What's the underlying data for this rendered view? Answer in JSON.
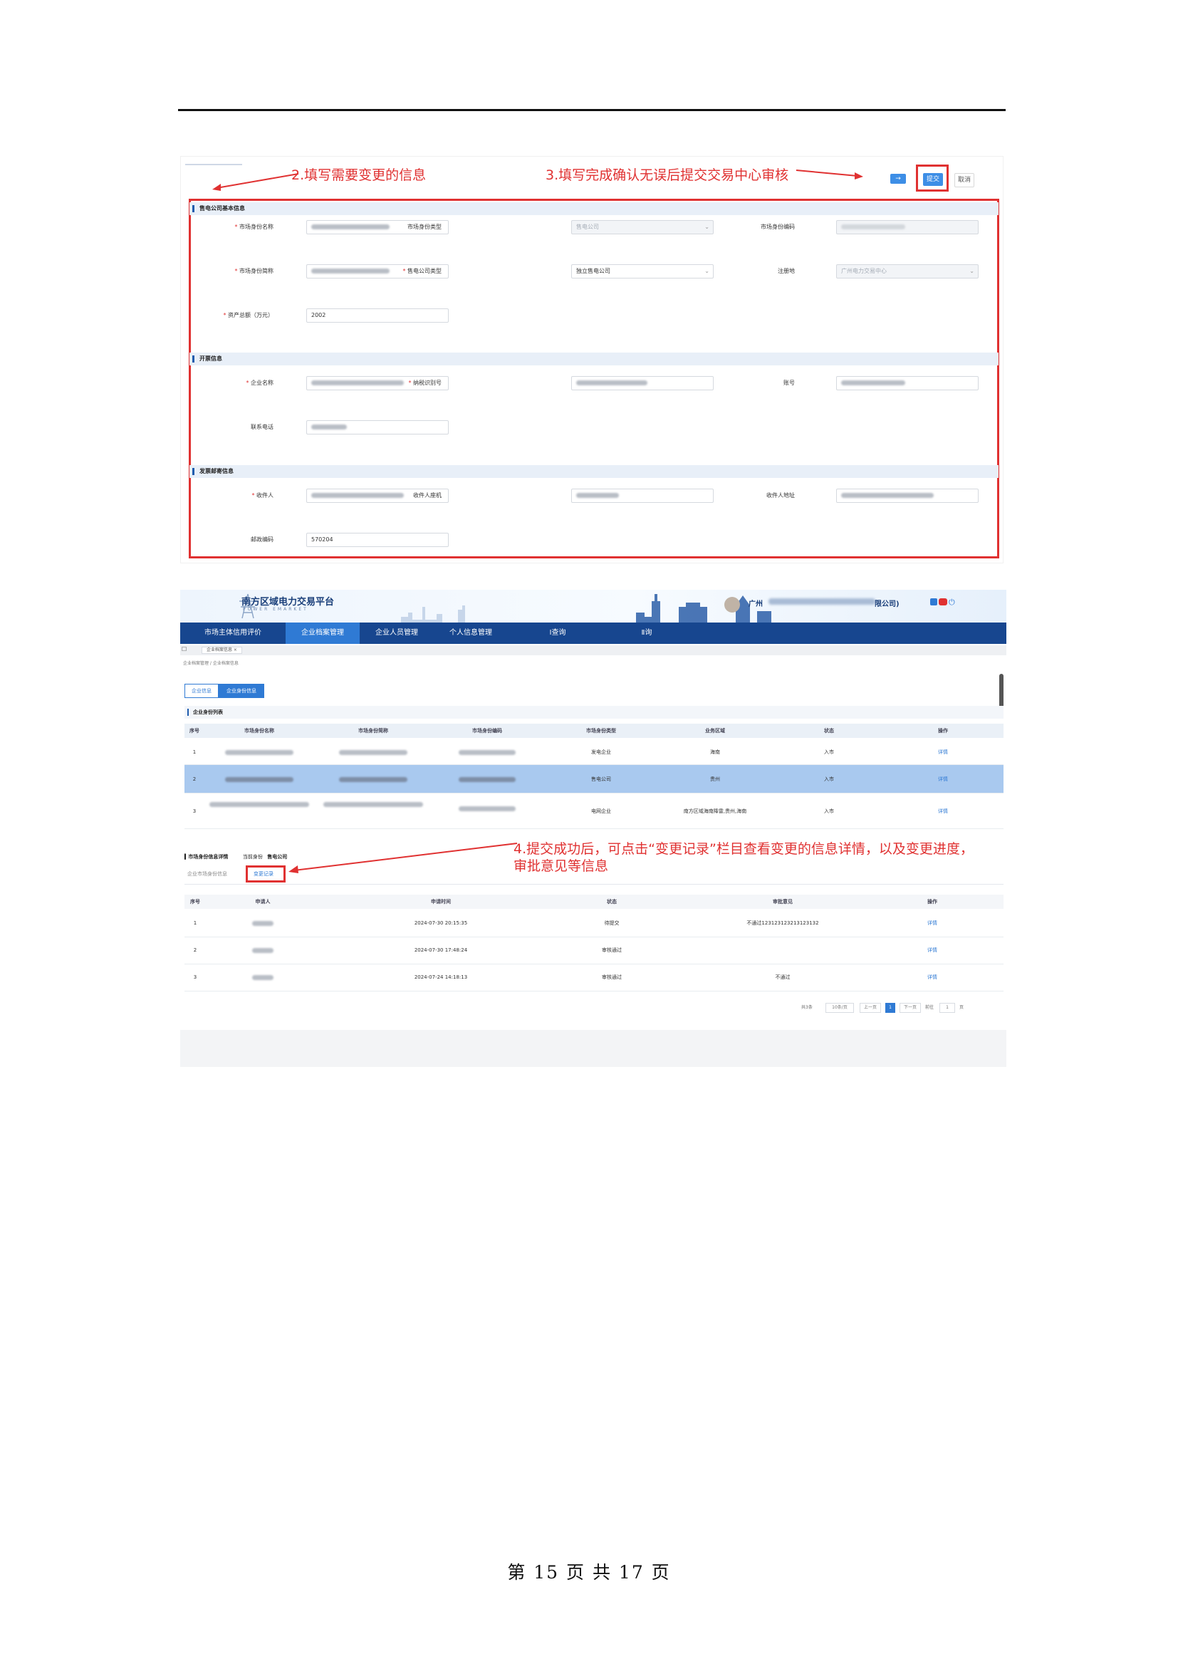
{
  "annotations": {
    "step2": "2.填写需要变更的信息",
    "step3": "3.填写完成确认无误后提交交易中心审核",
    "step4_line1": "4.提交成功后，可点击“变更记录”栏目查看变更的信息详情，以及变更进度，",
    "step4_line2": "审批意见等信息"
  },
  "form": {
    "submit_label": "提交",
    "cancel_label": "取消",
    "section1": "售电公司基本信息",
    "section2": "开票信息",
    "section3": "发票邮寄信息",
    "fields": {
      "name_label": "市场身份名称",
      "type_label": "市场身份类型",
      "type_value": "售电公司",
      "code_label": "市场身份编码",
      "short_label": "市场身份简称",
      "company_type_label": "售电公司类型",
      "company_type_value": "独立售电公司",
      "reg_label": "注册地",
      "reg_value": "广州电力交易中心",
      "capital_label": "资产总额（万元）",
      "capital_value": "2002",
      "corp_label": "企业名称",
      "tax_label": "纳税识别号",
      "account_label": "账号",
      "phone_label": "联系电话",
      "recipient_label": "收件人",
      "recipient_phone_label": "收件人座机",
      "address_label": "收件人地址",
      "postcode_label": "邮政编码",
      "postcode_value": "570204"
    }
  },
  "platform": {
    "title": "南方区域电力交易平台",
    "subtitle": "POWER EMARKET",
    "user_prefix": "广州",
    "user_suffix": "限公司)",
    "nav": [
      {
        "label": "市场主体信用评价"
      },
      {
        "label": "企业档案管理"
      },
      {
        "label": "企业人员管理"
      },
      {
        "label": "个人信息管理"
      },
      {
        "label": "Ⅰ查询"
      },
      {
        "label": "Ⅱ询"
      }
    ],
    "tab_label": "企业档案信息",
    "breadcrumb": "企业档案管理 / 企业档案信息",
    "seg_left": "企业信息",
    "seg_right": "企业身份信息",
    "list_title": "企业身份列表",
    "list_columns": [
      "序号",
      "市场身份名称",
      "市场身份简称",
      "市场身份编码",
      "市场身份类型",
      "业务区域",
      "状态",
      "操作"
    ],
    "list_rows": [
      {
        "no": "1",
        "type": "发电企业",
        "region": "海南",
        "status": "入市",
        "op": "详情"
      },
      {
        "no": "2",
        "type": "售电公司",
        "region": "贵州",
        "status": "入市",
        "op": "详情"
      },
      {
        "no": "3",
        "type": "电网企业",
        "region": "南方区域海南降雷,贵州,海南",
        "status": "入市",
        "op": "详情"
      }
    ],
    "detail_title": "市场身份信息详情",
    "current_identity_label": "当前身份",
    "current_identity_value": "售电公司",
    "subtab_info": "企业市场身份信息",
    "subtab_records": "变更记录",
    "record_columns": [
      "序号",
      "申请人",
      "申请时间",
      "状态",
      "审批意见",
      "操作"
    ],
    "record_rows": [
      {
        "no": "1",
        "time": "2024-07-30 20:15:35",
        "status": "待提交",
        "opinion": "不通过123123123213123132",
        "op": "详情"
      },
      {
        "no": "2",
        "time": "2024-07-30 17:48:24",
        "status": "审核通过",
        "opinion": "",
        "op": "详情"
      },
      {
        "no": "3",
        "time": "2024-07-24 14:18:13",
        "status": "审核通过",
        "opinion": "不通过",
        "op": "详情"
      }
    ],
    "pager": {
      "total": "共3条",
      "page_size": "10条/页",
      "prev": "上一页",
      "current": "1",
      "next": "下一页",
      "goto": "前往",
      "goto_value": "1",
      "page_unit": "页"
    }
  },
  "footer": {
    "page_label": "第 15 页 共 17 页"
  }
}
